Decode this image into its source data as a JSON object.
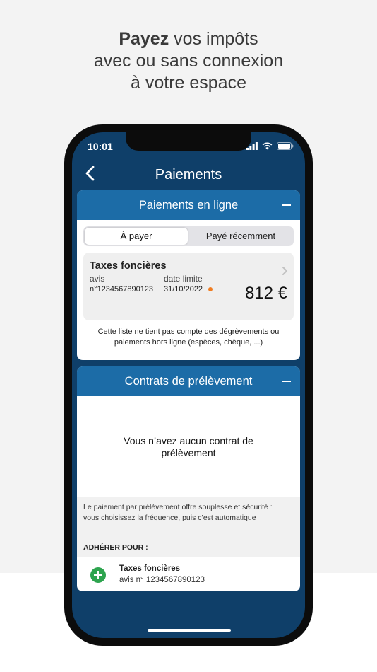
{
  "headline": {
    "bold": "Payez",
    "line1_rest": " vos impôts",
    "line2": "avec ou sans connexion",
    "line3": "à votre espace"
  },
  "status_bar": {
    "time": "10:01"
  },
  "nav": {
    "title": "Paiements"
  },
  "online_payments": {
    "title": "Paiements en ligne",
    "tabs": [
      {
        "label": "À payer",
        "selected": true
      },
      {
        "label": "Payé récemment",
        "selected": false
      }
    ],
    "item": {
      "title": "Taxes foncières",
      "avis_label": "avis",
      "avis_value": "n°1234567890123",
      "date_label": "date limite",
      "date_value": "31/10/2022",
      "amount": "812 €"
    },
    "note_line1": "Cette liste ne tient pas compte des dégrèvements ou",
    "note_line2": "paiements hors ligne (espèces, chèque, ...)"
  },
  "direct_debit": {
    "title": "Contrats de prélèvement",
    "empty_line1": "Vous n’avez aucun contrat de",
    "empty_line2": "prélèvement",
    "info_line1": "Le paiement par prélèvement offre souplesse et sécurité :",
    "info_line2": "vous choisissez la fréquence, puis c’est automatique",
    "adherer_label": "ADHÉRER POUR :",
    "adherer_item": {
      "title": "Taxes foncières",
      "subtitle": "avis n° 1234567890123"
    }
  },
  "colors": {
    "screen_bg": "#0f3f69",
    "card_header": "#1c6ca7",
    "deadline_dot": "#f07d22",
    "add_button": "#2da44e"
  }
}
